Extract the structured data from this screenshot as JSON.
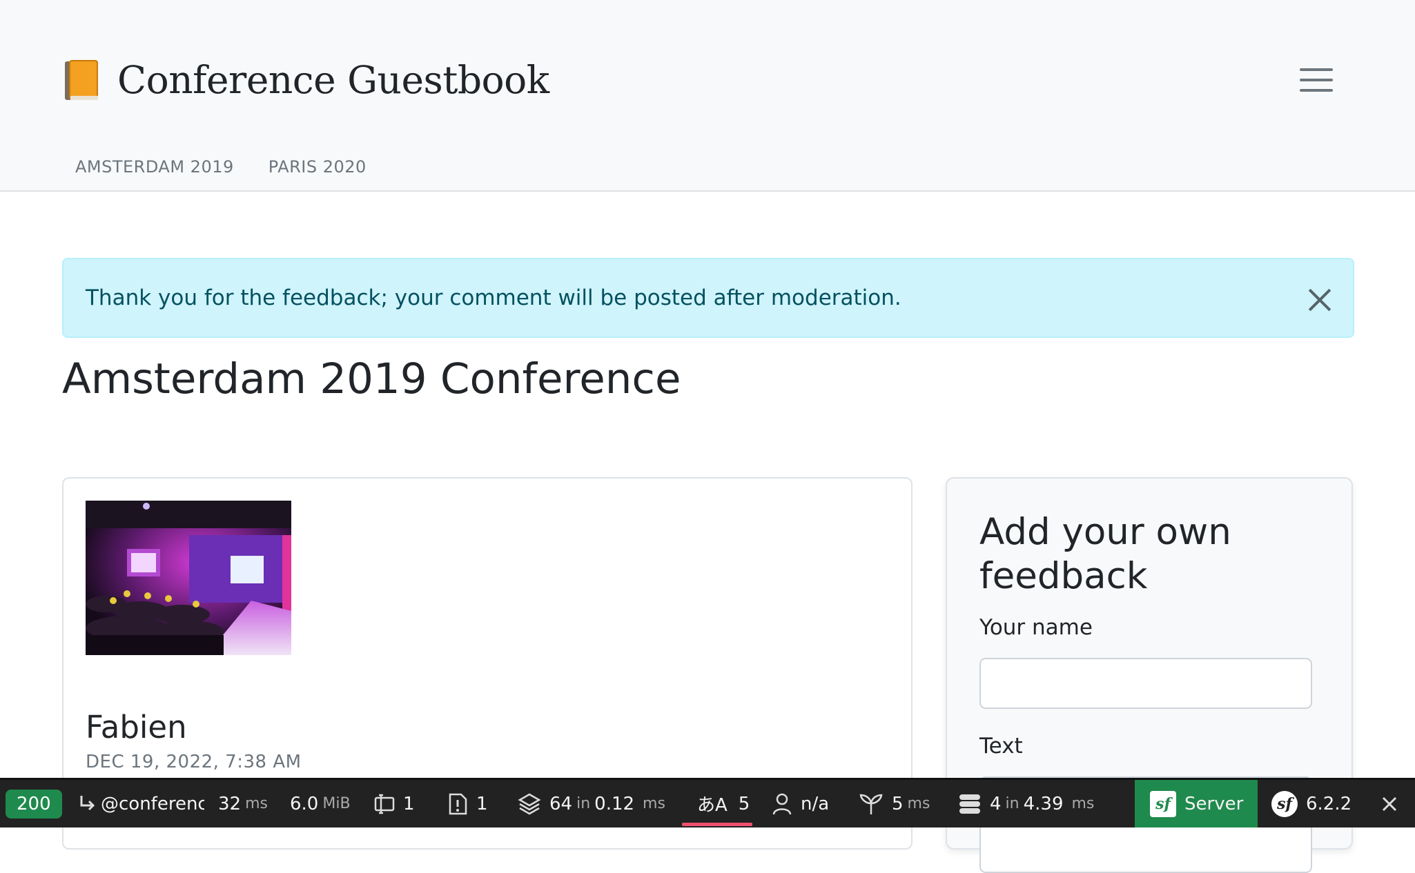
{
  "header": {
    "brand_title": "Conference Guestbook",
    "brand_icon": "orange-book-icon",
    "menu_icon": "hamburger-menu-icon",
    "nav": [
      {
        "label": "AMSTERDAM 2019"
      },
      {
        "label": "PARIS 2020"
      }
    ]
  },
  "alert": {
    "message": "Thank you for the feedback; your comment will be posted after moderation.",
    "close_icon": "close-icon"
  },
  "main": {
    "page_title": "Amsterdam 2019 Conference"
  },
  "comment": {
    "author": "Fabien",
    "date": "DEC 19, 2022, 7:38 AM"
  },
  "form": {
    "title": "Add your own feedback",
    "name_label": "Your name",
    "name_value": "",
    "text_label": "Text"
  },
  "toolbar": {
    "status_code": "200",
    "route": "@conference",
    "time_value": "32",
    "time_unit": "ms",
    "memory_value": "6.0",
    "memory_unit": "MiB",
    "forms_count": "1",
    "exceptions_count": "1",
    "cache_count": "64",
    "cache_in": "in",
    "cache_time": "0.12",
    "cache_unit": "ms",
    "translation_count": "5",
    "user_value": "n/a",
    "twig_value": "5",
    "twig_unit": "ms",
    "db_count": "4",
    "db_in": "in",
    "db_time": "4.39",
    "db_unit": "ms",
    "server_label": "Server",
    "version": "6.2.2",
    "colors": {
      "background": "#222222",
      "success": "#1f8a4d",
      "accent": "#f0506e"
    }
  }
}
